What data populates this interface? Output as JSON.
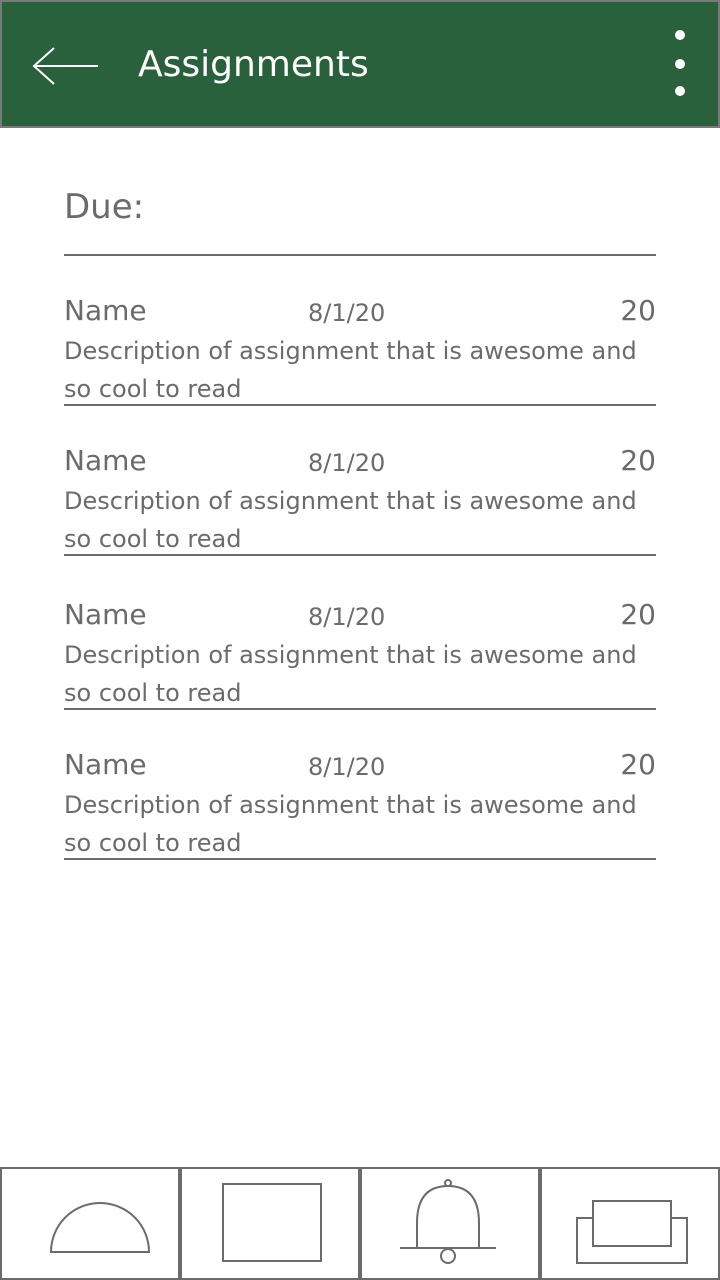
{
  "header": {
    "title": "Assignments",
    "back_icon": "arrow-left-icon",
    "menu_icon": "more-vertical-icon",
    "bg_color": "#2a613d"
  },
  "due_section": {
    "label": "Due:"
  },
  "assignments": [
    {
      "name": "Name",
      "date": "8/1/20",
      "points": "20",
      "description": "Description of assignment that is awesome and so cool to read"
    },
    {
      "name": "Name",
      "date": "8/1/20",
      "points": "20",
      "description": "Description of assignment that is awesome and so cool to read"
    },
    {
      "name": "Name",
      "date": "8/1/20",
      "points": "20",
      "description": "Description of assignment that is awesome and so cool to read"
    },
    {
      "name": "Name",
      "date": "8/1/20",
      "points": "20",
      "description": "Description of assignment that is awesome and so cool to read"
    }
  ],
  "bottom_nav": {
    "tabs": [
      {
        "icon": "semicircle-icon"
      },
      {
        "icon": "square-icon"
      },
      {
        "icon": "bell-icon"
      },
      {
        "icon": "stacked-cards-icon"
      }
    ]
  }
}
